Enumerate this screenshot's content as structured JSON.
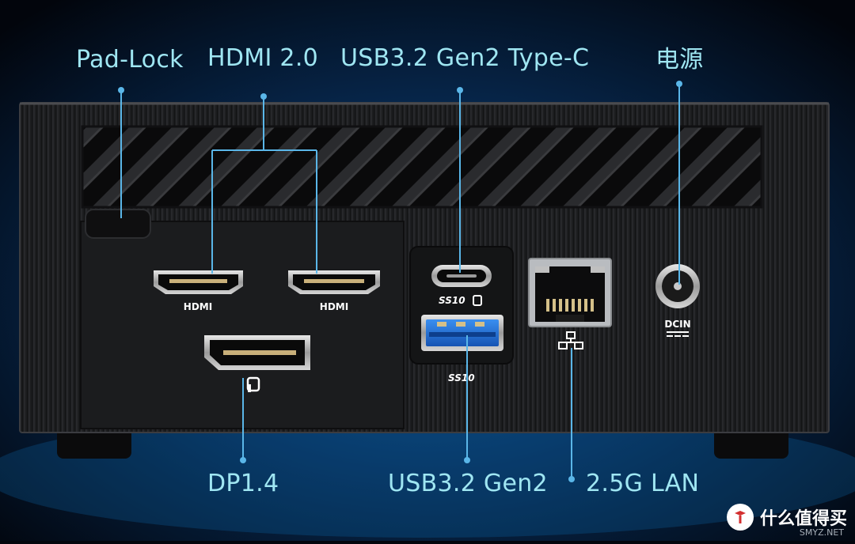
{
  "labels": {
    "pad_lock": "Pad-Lock",
    "hdmi": "HDMI 2.0",
    "usb_c": "USB3.2 Gen2 Type-C",
    "power": "电源",
    "dp": "DP1.4",
    "usb_a": "USB3.2 Gen2",
    "lan": "2.5G LAN"
  },
  "port_marks": {
    "hdmi_1": "HDMI",
    "hdmi_2": "HDMI",
    "dcin": "DCIN",
    "ss10_c": "SS10",
    "ss10_a": "SS10"
  },
  "watermark": {
    "text": "什么值得买",
    "site": "SMYZ.NET"
  },
  "colors": {
    "label": "#9fe6f2",
    "leader": "#5ab6e8",
    "chassis": "#1a1b1d",
    "usb_blue": "#1f6fd6",
    "background_glow": "#0c4f8a"
  }
}
